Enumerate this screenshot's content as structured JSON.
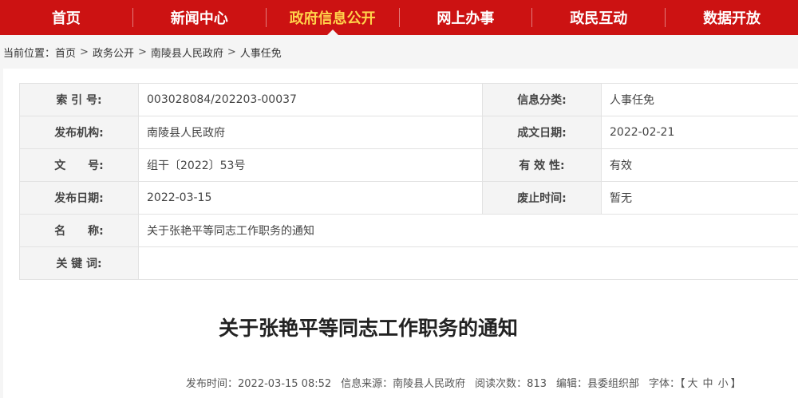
{
  "nav": {
    "items": [
      {
        "label": "首页"
      },
      {
        "label": "新闻中心"
      },
      {
        "label": "政府信息公开"
      },
      {
        "label": "网上办事"
      },
      {
        "label": "政民互动"
      },
      {
        "label": "数据开放"
      }
    ],
    "active_index": 2
  },
  "breadcrumb": {
    "prefix": "当前位置：",
    "items": [
      "首页",
      "政务公开",
      "南陵县人民政府",
      "人事任免"
    ],
    "separator": ">"
  },
  "meta": {
    "index_label": "索 引 号:",
    "index_value": "003028084/202203-00037",
    "category_label": "信息分类:",
    "category_value": "人事任免",
    "publisher_label": "发布机构:",
    "publisher_value": "南陵县人民政府",
    "created_label": "成文日期:",
    "created_value": "2022-02-21",
    "docno_label": "文　　号:",
    "docno_value": "组干〔2022〕53号",
    "validity_label": "有 效 性:",
    "validity_value": "有效",
    "pubdate_label": "发布日期:",
    "pubdate_value": "2022-03-15",
    "expiry_label": "废止时间:",
    "expiry_value": "暂无",
    "name_label": "名　　称:",
    "name_value": "关于张艳平等同志工作职务的通知",
    "keywords_label": "关 键 词:",
    "keywords_value": ""
  },
  "article": {
    "title": "关于张艳平等同志工作职务的通知",
    "time_text": "发布时间：2022-03-15 08:52",
    "source_text": "信息来源：南陵县人民政府",
    "views_text": "阅读次数：813",
    "editor_text": "编辑：县委组织部",
    "font_label": "字体：【",
    "font_large": "大",
    "font_medium": "中",
    "font_small": "小",
    "font_end": "】"
  },
  "colors": {
    "nav_bg": "#cc1212",
    "nav_active": "#ffd24a"
  }
}
